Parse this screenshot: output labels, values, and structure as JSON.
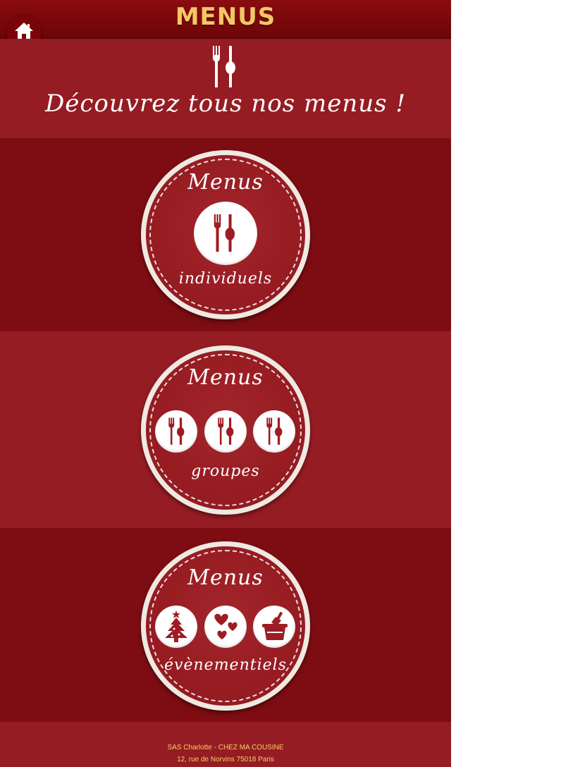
{
  "header": {
    "title": "MENUS"
  },
  "hero": {
    "tagline": "Découvrez tous nos menus !"
  },
  "menus": [
    {
      "top_label": "Menus",
      "bottom_label": "individuels"
    },
    {
      "top_label": "Menus",
      "bottom_label": "groupes"
    },
    {
      "top_label": "Menus",
      "bottom_label": "évènementiels"
    }
  ],
  "footer": {
    "company": "SAS Charlotte - CHEZ MA COUSINE",
    "address": "12, rue de Norvins 75018 Paris"
  },
  "icons": {
    "home": "home-icon",
    "cutlery": "cutlery-icon",
    "tree": "christmas-tree-icon",
    "hearts": "hearts-icon",
    "champagne": "champagne-bucket-icon"
  },
  "colors": {
    "header": "#7a0508",
    "title": "#f3c765",
    "band_dark": "#7d0d12",
    "band_light": "#951c22",
    "footer_text": "#f5d16a"
  }
}
